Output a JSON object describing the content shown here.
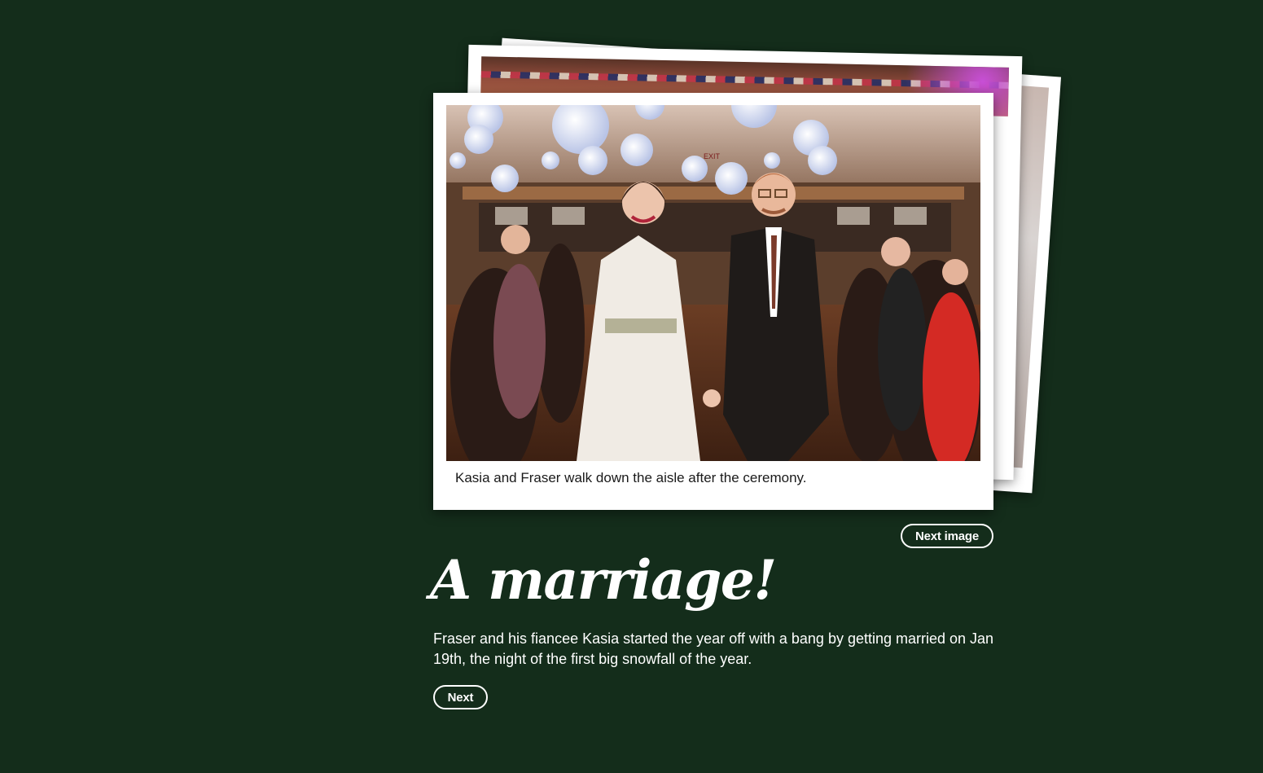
{
  "colors": {
    "background": "#142d1b",
    "card": "#ffffff",
    "text_light": "#ffffff",
    "text_dark": "#1a1a1a"
  },
  "photo": {
    "caption": "Kasia and Fraser walk down the aisle after the ceremony.",
    "alt": "Kasia and Fraser walk down the aisle after the ceremony."
  },
  "buttons": {
    "next_image": "Next image",
    "next": "Next"
  },
  "story": {
    "title": "A marriage!",
    "body": "Fraser and his fiancee Kasia started the year off with a bang by getting married on Jan 19th, the night of the first big snowfall of the year."
  }
}
